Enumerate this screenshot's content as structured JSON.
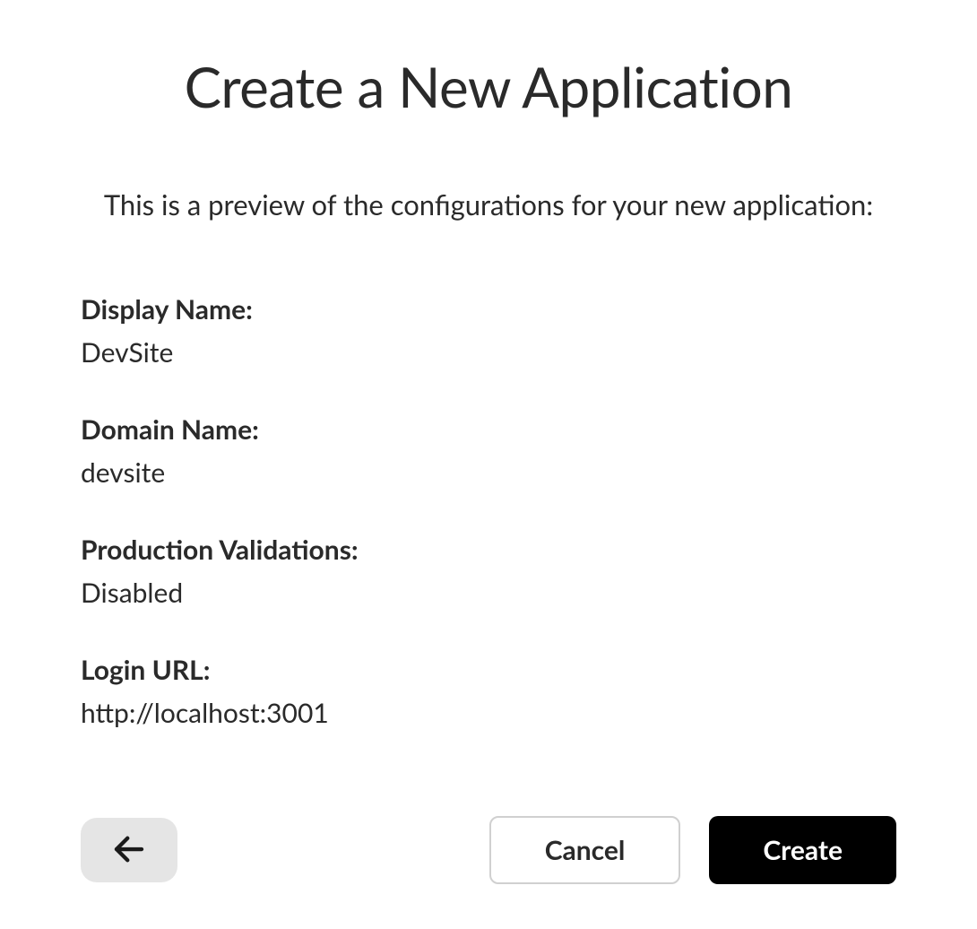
{
  "header": {
    "title": "Create a New Application",
    "subtitle": "This is a preview of the configurations for your new application:"
  },
  "config": {
    "displayName": {
      "label": "Display Name:",
      "value": "DevSite"
    },
    "domainName": {
      "label": "Domain Name:",
      "value": "devsite"
    },
    "productionValidations": {
      "label": "Production Validations:",
      "value": "Disabled"
    },
    "loginUrl": {
      "label": "Login URL:",
      "value": "http://localhost:3001"
    }
  },
  "footer": {
    "cancelLabel": "Cancel",
    "createLabel": "Create"
  }
}
